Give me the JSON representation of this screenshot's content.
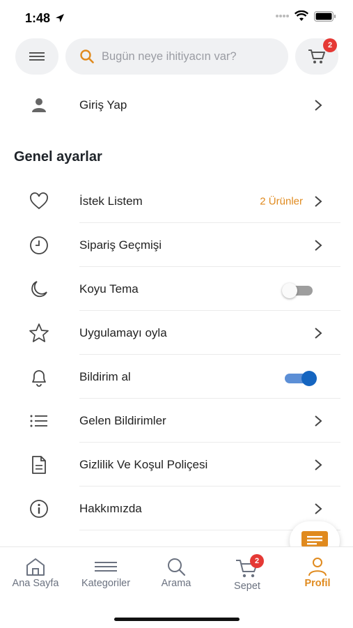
{
  "status": {
    "time": "1:48"
  },
  "search": {
    "placeholder": "Bugün neye ihitiyacın var?"
  },
  "cart": {
    "count": "2"
  },
  "login": {
    "label": "Giriş Yap"
  },
  "section": {
    "title": "Genel ayarlar"
  },
  "settings": [
    {
      "icon": "heart-icon",
      "label": "İstek Listem",
      "value": "2 Ürünler",
      "type": "link"
    },
    {
      "icon": "clock-icon",
      "label": "Sipariş Geçmişi",
      "type": "link"
    },
    {
      "icon": "moon-icon",
      "label": "Koyu Tema",
      "type": "toggle",
      "enabled": false
    },
    {
      "icon": "star-icon",
      "label": "Uygulamayı oyla",
      "type": "link"
    },
    {
      "icon": "bell-icon",
      "label": "Bildirim al",
      "type": "toggle",
      "enabled": true
    },
    {
      "icon": "list-icon",
      "label": "Gelen Bildirimler",
      "type": "link"
    },
    {
      "icon": "document-icon",
      "label": "Gizlilik Ve Koşul Poliçesi",
      "type": "link"
    },
    {
      "icon": "info-icon",
      "label": "Hakkımızda",
      "type": "link"
    }
  ],
  "tabs": [
    {
      "icon": "home-icon",
      "label": "Ana Sayfa",
      "active": false
    },
    {
      "icon": "categories-icon",
      "label": "Kategoriler",
      "active": false
    },
    {
      "icon": "search-icon",
      "label": "Arama",
      "active": false
    },
    {
      "icon": "cart-icon",
      "label": "Sepet",
      "active": false,
      "badge": "2"
    },
    {
      "icon": "profile-icon",
      "label": "Profil",
      "active": true
    }
  ],
  "colors": {
    "accent": "#e08a1e",
    "toggle_on": "#1565c0",
    "badge": "#e53935"
  }
}
